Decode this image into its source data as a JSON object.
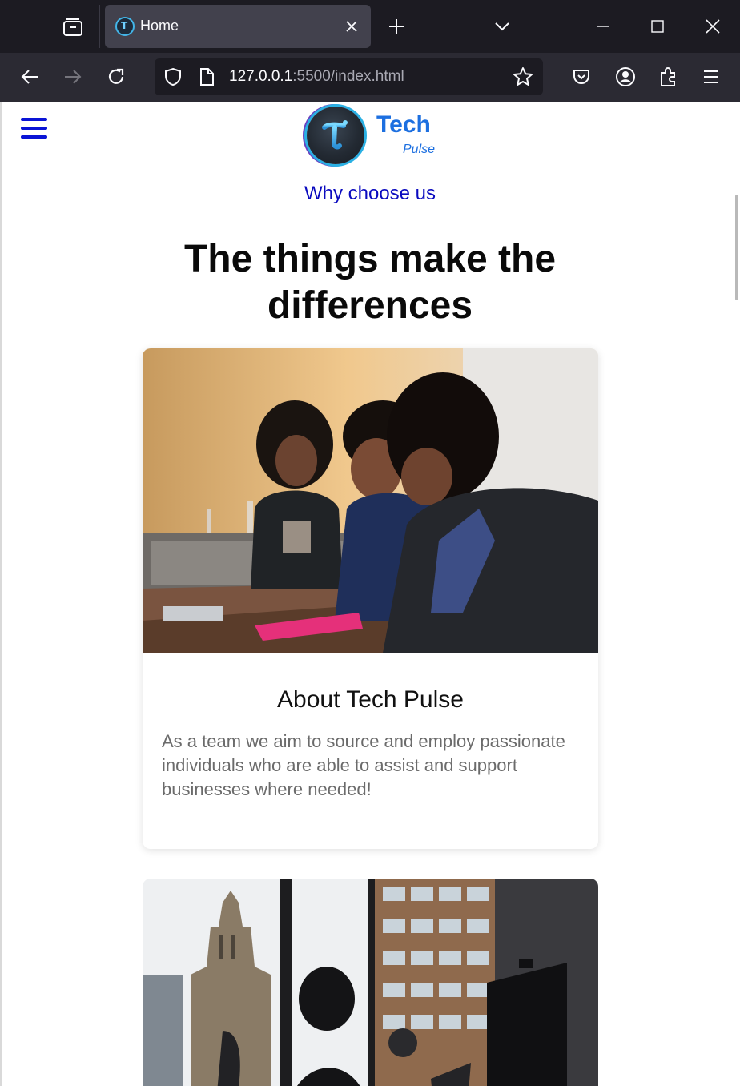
{
  "browser": {
    "tab_title": "Home",
    "url_host": "127.0.0.1",
    "url_rest": ":5500/index.html"
  },
  "site": {
    "brand_name": "Tech",
    "brand_tagline": "Pulse",
    "eyebrow": "Why choose us",
    "headline_line1": "The things make the",
    "headline_line2": "differences"
  },
  "cards": [
    {
      "title": "About Tech Pulse",
      "text": "As a team we aim to source and employ passionate individuals who are able to assist and support businesses where needed!"
    }
  ],
  "colors": {
    "chrome_bg": "#1c1b22",
    "toolbar_bg": "#2b2a33",
    "brand_blue": "#1c6fe0",
    "eyebrow_blue": "#0b0bbf",
    "hamburger_blue": "#0a14d6"
  },
  "icons": {
    "tab_overview": "tab-overview-icon",
    "back": "arrow-left-icon",
    "forward": "arrow-right-icon",
    "reload": "reload-icon",
    "shield": "shield-icon",
    "page": "page-icon",
    "star": "star-icon",
    "pocket": "pocket-icon",
    "account": "account-icon",
    "extensions": "puzzle-icon",
    "menu": "hamburger-menu-icon"
  }
}
